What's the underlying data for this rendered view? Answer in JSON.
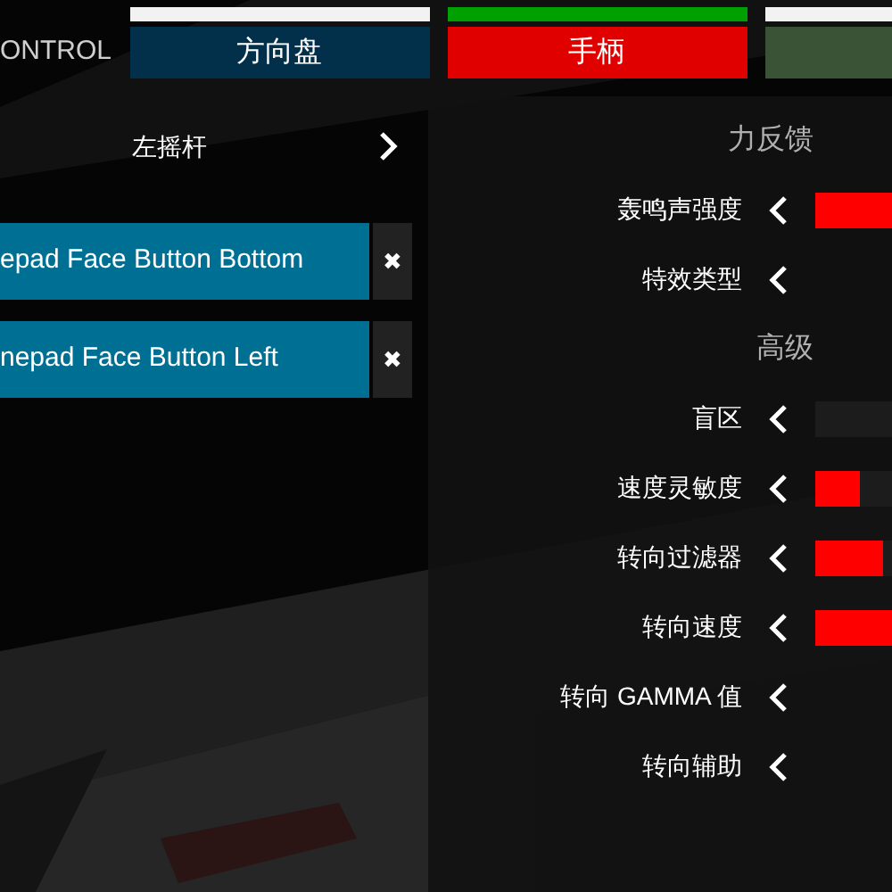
{
  "header": {
    "title": "ONTROL"
  },
  "tabs": [
    {
      "label": "方向盘",
      "selected": false,
      "color": "#02304a"
    },
    {
      "label": "手柄",
      "selected": true,
      "color": "#e00000"
    },
    {
      "selected": false,
      "color": "#3a5235"
    }
  ],
  "left": {
    "stick": "左摇杆",
    "bindings": [
      {
        "label": "epad Face Button Bottom",
        "remove": "✖"
      },
      {
        "label": "nepad Face Button Left",
        "remove": "✖"
      }
    ]
  },
  "settings": [
    {
      "kind": "header",
      "label": "力反馈"
    },
    {
      "kind": "slider",
      "label": "轰鸣声强度",
      "level": 1
    },
    {
      "kind": "option",
      "label": "特效类型"
    },
    {
      "kind": "header",
      "label": "高级"
    },
    {
      "kind": "slider",
      "label": "盲区",
      "level": 0
    },
    {
      "kind": "slider",
      "label": "速度灵敏度",
      "level": 0.58
    },
    {
      "kind": "slider",
      "label": "转向过滤器",
      "level": 0.88
    },
    {
      "kind": "slider",
      "label": "转向速度",
      "level": 1
    },
    {
      "kind": "option",
      "label": "转向 GAMMA 值"
    },
    {
      "kind": "option",
      "label": "转向辅助"
    }
  ]
}
